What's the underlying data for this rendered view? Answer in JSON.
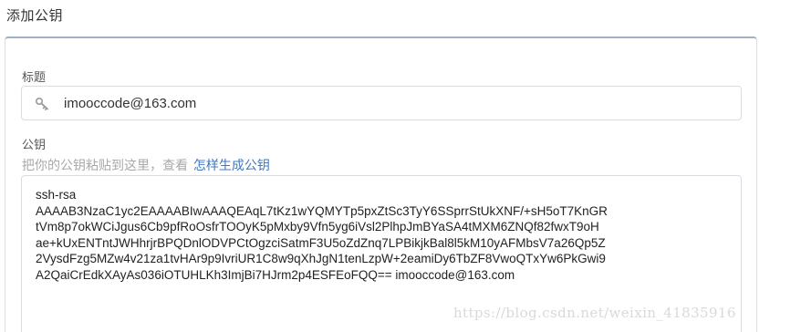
{
  "page": {
    "title": "添加公钥"
  },
  "form": {
    "title_label": "标题",
    "title_value": "imooccode@163.com",
    "key_label": "公钥",
    "hint_text": "把你的公钥粘贴到这里，查看 ",
    "hint_link": "怎样生成公钥",
    "key_value": "ssh-rsa\nAAAAB3NzaC1yc2EAAAABIwAAAQEAqL7tKz1wYQMYTp5pxZtSc3TyY6SSprrStUkXNF/+sH5oT7KnGR\ntVm8p7okWCiJgus6Cb9pfRoOsfrTOOyK5pMxby9Vfn5yg6iVsl2PlhpJmBYaSA4tMXM6ZNQf82fwxT9oH\nae+kUxENTntJWHhrjrBPQDnlODVPCtOgzciSatmF3U5oZdZnq7LPBikjkBal8l5kM10yAFMbsV7a26Qp5Z\n2VysdFzg5MZw4v21za1tvHAr9p9IvriUR1C8w9qXhJgN1tenLzpW+2eamiDy6TbZF8VwoQTxYw6PkGwi9\nA2QaiCrEdkXAyAs036iOTUHLKh3ImjBi7HJrm2p4ESFEoFQQ== imooccode@163.com"
  },
  "watermark": {
    "text": "https://blog.csdn.net/weixin_41835916"
  },
  "icons": {
    "title_input_icon": "key-icon",
    "resize_handle": "resize-grip-icon"
  },
  "colors": {
    "link": "#4078c0",
    "card_top_border": "#9fb1c8",
    "hint": "#a9a9a9"
  }
}
